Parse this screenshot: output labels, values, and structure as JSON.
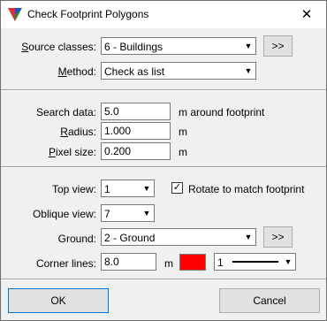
{
  "window": {
    "title": "Check Footprint Polygons",
    "close_glyph": "✕"
  },
  "source_classes": {
    "label": "Source classes:",
    "accel": "S",
    "rest": "ource classes:",
    "value": "6 - Buildings",
    "more_label": ">>"
  },
  "method": {
    "accel": "M",
    "rest": "ethod:",
    "value": "Check as list"
  },
  "search_data": {
    "label": "Search data:",
    "value": "5.0",
    "unit": "m around footprint"
  },
  "radius": {
    "accel": "R",
    "rest": "adius:",
    "value": "1.000",
    "unit": "m"
  },
  "pixel_size": {
    "accel": "P",
    "rest": "ixel size:",
    "value": "0.200",
    "unit": "m"
  },
  "top_view": {
    "label": "Top view:",
    "value": "1"
  },
  "rotate": {
    "label": "Rotate to match footprint",
    "checked_glyph": "✓",
    "checked": true
  },
  "oblique_view": {
    "label": "Oblique view:",
    "value": "7"
  },
  "ground": {
    "label": "Ground:",
    "value": "2 - Ground",
    "more_label": ">>"
  },
  "corner_lines": {
    "label": "Corner lines:",
    "value": "8.0",
    "unit": "m",
    "color": "#ff0000",
    "line_weight": "1"
  },
  "buttons": {
    "ok": "OK",
    "cancel": "Cancel"
  }
}
